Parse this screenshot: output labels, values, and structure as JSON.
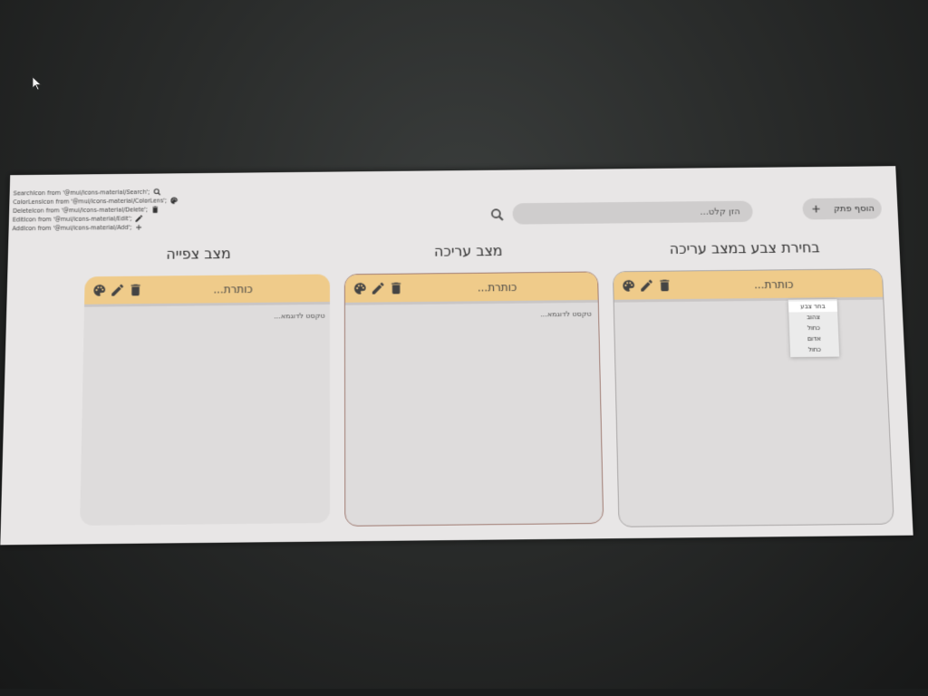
{
  "imports": [
    {
      "text": "SearchIcon from '@mui/icons-material/Search';",
      "icon": "search-icon"
    },
    {
      "text": "ColorLensIcon from '@mui/icons-material/ColorLens';",
      "icon": "color-lens-icon"
    },
    {
      "text": "DeleteIcon from '@mui/icons-material/Delete';",
      "icon": "delete-icon"
    },
    {
      "text": "EditIcon from '@mui/icons-material/Edit';",
      "icon": "edit-icon"
    },
    {
      "text": "AddIcon from '@mui/icons-material/Add';",
      "icon": "add-icon"
    }
  ],
  "toolbar": {
    "add_note_label": "הוסף פתק",
    "search_placeholder": "הזן קלט..."
  },
  "sections": {
    "color_select_title": "בחירת צבע במצב עריכה",
    "edit_mode_title": "מצב עריכה",
    "view_mode_title": "מצב צפייה"
  },
  "cards": {
    "color_select": {
      "title": "כותרת...",
      "body": ""
    },
    "edit_mode": {
      "title": "כותרת...",
      "body": "טקסט לדוגמא..."
    },
    "view_mode": {
      "title": "כותרת...",
      "body": "טקסט לדוגמא..."
    }
  },
  "color_menu": {
    "items": [
      "בחר צבע",
      "צהוב",
      "כחול",
      "אדום",
      "כחול"
    ]
  },
  "colors": {
    "card_header": "#efcb8a",
    "card_body": "#dedcdc",
    "edit_border": "#a07c73",
    "screen_bg": "#e8e6e6",
    "pill_bg": "#cfcdcd"
  }
}
